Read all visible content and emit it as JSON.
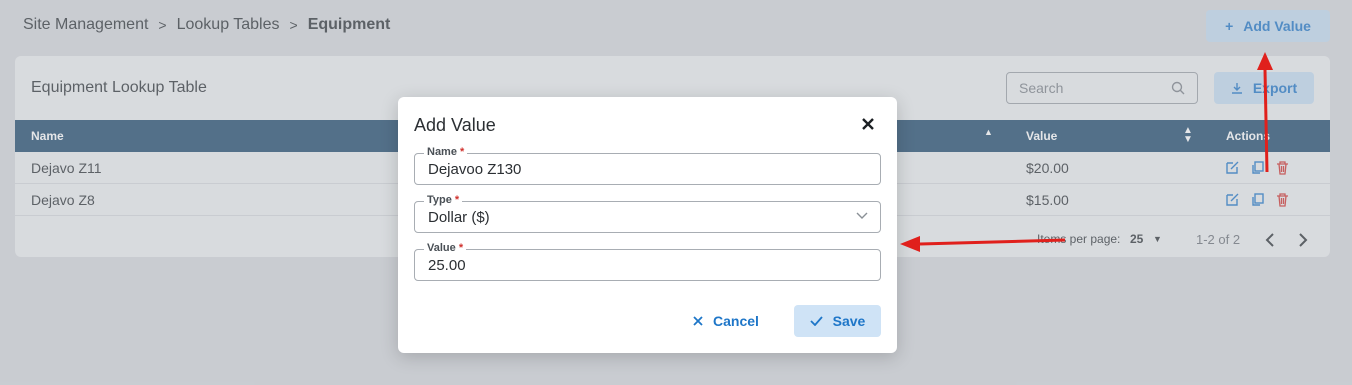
{
  "breadcrumb": {
    "item1": "Site Management",
    "item2": "Lookup Tables",
    "current": "Equipment",
    "separator": ">"
  },
  "header": {
    "add_value_label": "Add Value"
  },
  "card": {
    "title": "Equipment Lookup Table",
    "search_placeholder": "Search",
    "export_label": "Export"
  },
  "table": {
    "columns": {
      "name": "Name",
      "value": "Value",
      "actions": "Actions"
    },
    "rows": [
      {
        "name": "Dejavo Z11",
        "value": "$20.00"
      },
      {
        "name": "Dejavo Z8",
        "value": "$15.00"
      }
    ]
  },
  "pagination": {
    "items_per_page_label": "Items per page:",
    "items_per_page": "25",
    "range": "1-2 of 2"
  },
  "dialog": {
    "title": "Add Value",
    "name_label": "Name",
    "name_value": "Dejavoo Z130",
    "type_label": "Type",
    "type_value": "Dollar ($)",
    "value_label": "Value",
    "value_value": "25.00",
    "required_mark": "*",
    "cancel_label": "Cancel",
    "save_label": "Save"
  },
  "colors": {
    "accent": "#1e76c8",
    "header": "#1f4a6e",
    "delete": "#d0312d",
    "annotation": "#e0201c"
  }
}
